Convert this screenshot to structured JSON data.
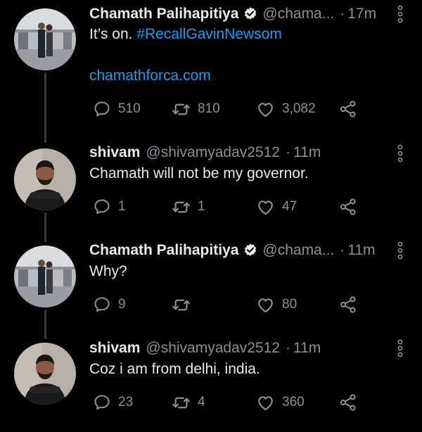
{
  "colors": {
    "background": "#000000",
    "text": "#e7e9ea",
    "muted": "#8b8f94",
    "link": "#1d9bf0",
    "connector": "#3a3a3a"
  },
  "tweets": [
    {
      "display_name": "Chamath Palihapitiya",
      "verified": true,
      "handle": "@chama...",
      "separator": "·",
      "time": "17m",
      "text_plain": "It’s on. ",
      "hashtag": "#RecallGavinNewsom",
      "link": "chamathforca.com",
      "replies": "510",
      "retweets": "810",
      "likes": "3,082"
    },
    {
      "display_name": "shivam",
      "verified": false,
      "handle": "@shivamyadav2512",
      "separator": "·",
      "time": "11m",
      "text": "Chamath will not be my governor.",
      "replies": "1",
      "retweets": "1",
      "likes": "47"
    },
    {
      "display_name": "Chamath Palihapitiya",
      "verified": true,
      "handle": "@chama...",
      "separator": "·",
      "time": "11m",
      "text": "Why?",
      "replies": "9",
      "retweets": "",
      "likes": "80"
    },
    {
      "display_name": "shivam",
      "verified": false,
      "handle": "@shivamyadav2512",
      "separator": "·",
      "time": "11m",
      "text": "Coz i am from delhi, india.",
      "replies": "23",
      "retweets": "4",
      "likes": "360"
    }
  ],
  "icons": {
    "reply": "reply-icon",
    "retweet": "retweet-icon",
    "like": "like-icon",
    "share": "share-icon",
    "more": "more-options-icon",
    "verified": "verified-badge-icon"
  }
}
